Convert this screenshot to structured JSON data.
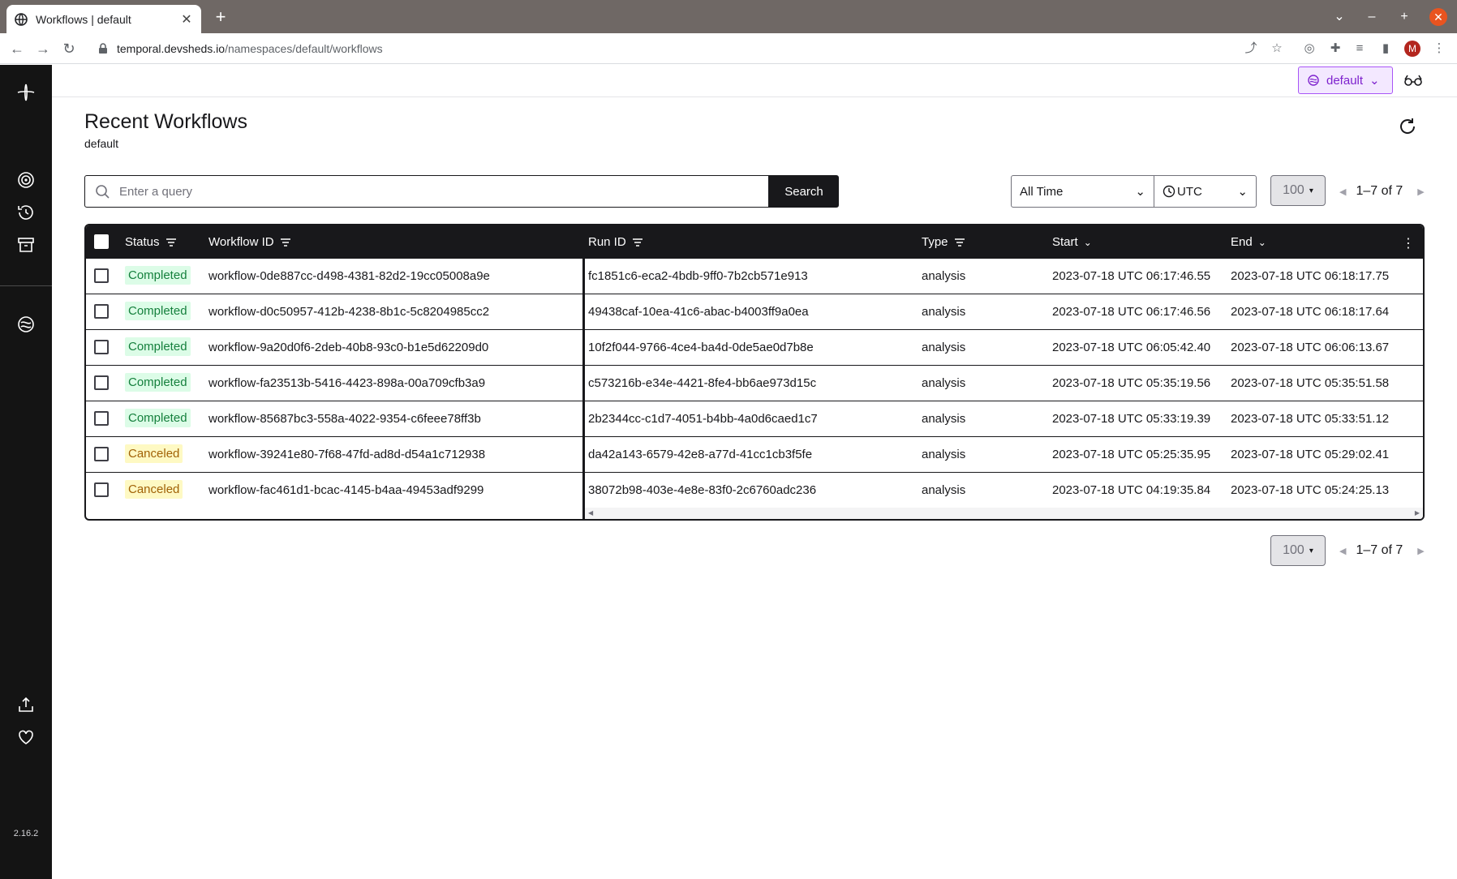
{
  "browser": {
    "tab_title": "Workflows | default",
    "url_host": "temporal.devsheds.io",
    "url_path": "/namespaces/default/workflows",
    "profile_initial": "M"
  },
  "app": {
    "version": "2.16.2",
    "namespace": "default",
    "title": "Recent Workflows",
    "subtitle": "default"
  },
  "search": {
    "placeholder": "Enter a query",
    "button": "Search"
  },
  "filters": {
    "time_range": "All Time",
    "timezone": "UTC",
    "per_page": "100",
    "range": "1–7 of 7"
  },
  "table": {
    "headers": {
      "status": "Status",
      "workflow_id": "Workflow ID",
      "run_id": "Run ID",
      "type": "Type",
      "start": "Start",
      "end": "End"
    },
    "rows": [
      {
        "status": "Completed",
        "workflow_id": "workflow-0de887cc-d498-4381-82d2-19cc05008a9e",
        "run_id": "fc1851c6-eca2-4bdb-9ff0-7b2cb571e913",
        "type": "analysis",
        "start": "2023-07-18 UTC 06:17:46.55",
        "end": "2023-07-18 UTC 06:18:17.75"
      },
      {
        "status": "Completed",
        "workflow_id": "workflow-d0c50957-412b-4238-8b1c-5c8204985cc2",
        "run_id": "49438caf-10ea-41c6-abac-b4003ff9a0ea",
        "type": "analysis",
        "start": "2023-07-18 UTC 06:17:46.56",
        "end": "2023-07-18 UTC 06:18:17.64"
      },
      {
        "status": "Completed",
        "workflow_id": "workflow-9a20d0f6-2deb-40b8-93c0-b1e5d62209d0",
        "run_id": "10f2f044-9766-4ce4-ba4d-0de5ae0d7b8e",
        "type": "analysis",
        "start": "2023-07-18 UTC 06:05:42.40",
        "end": "2023-07-18 UTC 06:06:13.67"
      },
      {
        "status": "Completed",
        "workflow_id": "workflow-fa23513b-5416-4423-898a-00a709cfb3a9",
        "run_id": "c573216b-e34e-4421-8fe4-bb6ae973d15c",
        "type": "analysis",
        "start": "2023-07-18 UTC 05:35:19.56",
        "end": "2023-07-18 UTC 05:35:51.58"
      },
      {
        "status": "Completed",
        "workflow_id": "workflow-85687bc3-558a-4022-9354-c6feee78ff3b",
        "run_id": "2b2344cc-c1d7-4051-b4bb-4a0d6caed1c7",
        "type": "analysis",
        "start": "2023-07-18 UTC 05:33:19.39",
        "end": "2023-07-18 UTC 05:33:51.12"
      },
      {
        "status": "Canceled",
        "workflow_id": "workflow-39241e80-7f68-47fd-ad8d-d54a1c712938",
        "run_id": "da42a143-6579-42e8-a77d-41cc1cb3f5fe",
        "type": "analysis",
        "start": "2023-07-18 UTC 05:25:35.95",
        "end": "2023-07-18 UTC 05:29:02.41"
      },
      {
        "status": "Canceled",
        "workflow_id": "workflow-fac461d1-bcac-4145-b4aa-49453adf9299",
        "run_id": "38072b98-403e-4e8e-83f0-2c6760adc236",
        "type": "analysis",
        "start": "2023-07-18 UTC 04:19:35.84",
        "end": "2023-07-18 UTC 05:24:25.13"
      }
    ]
  },
  "colors": {
    "completed_bg": "#dcfce7",
    "completed_fg": "#15803d",
    "canceled_bg": "#fef9c3",
    "canceled_fg": "#a16207",
    "namespace_accent": "#7e22ce"
  }
}
